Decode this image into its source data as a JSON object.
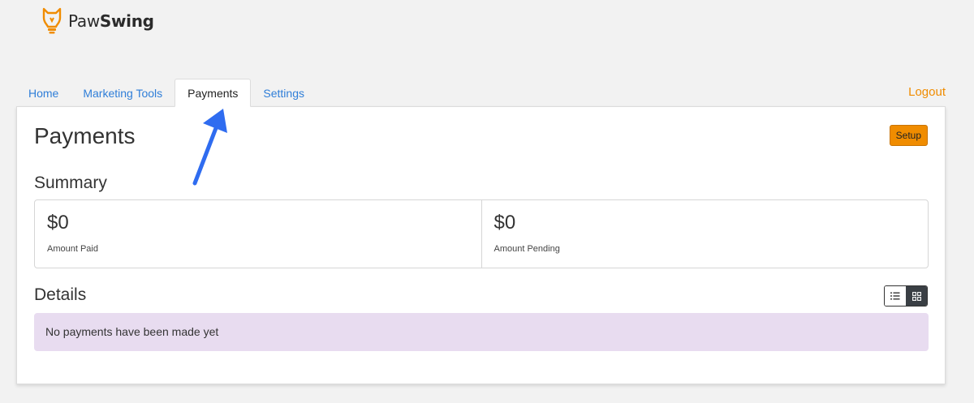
{
  "brand": {
    "name_regular": "Paw",
    "name_bold": "Swing",
    "accent_color": "#f08c00"
  },
  "nav": {
    "tabs": [
      {
        "label": "Home"
      },
      {
        "label": "Marketing Tools"
      },
      {
        "label": "Payments",
        "active": true
      },
      {
        "label": "Settings"
      }
    ],
    "logout_label": "Logout"
  },
  "main": {
    "title": "Payments",
    "setup_label": "Setup",
    "summary": {
      "title": "Summary",
      "stats": [
        {
          "value": "$0",
          "label": "Amount Paid"
        },
        {
          "value": "$0",
          "label": "Amount Pending"
        }
      ]
    },
    "details": {
      "title": "Details",
      "empty_message": "No payments have been made yet",
      "view_modes": [
        {
          "icon": "list-icon",
          "selected": false
        },
        {
          "icon": "grid-icon",
          "selected": true
        }
      ]
    }
  },
  "colors": {
    "link": "#2f7ed8",
    "alert_bg": "#e8dcf0",
    "annotation_arrow": "#2f6cf0"
  }
}
